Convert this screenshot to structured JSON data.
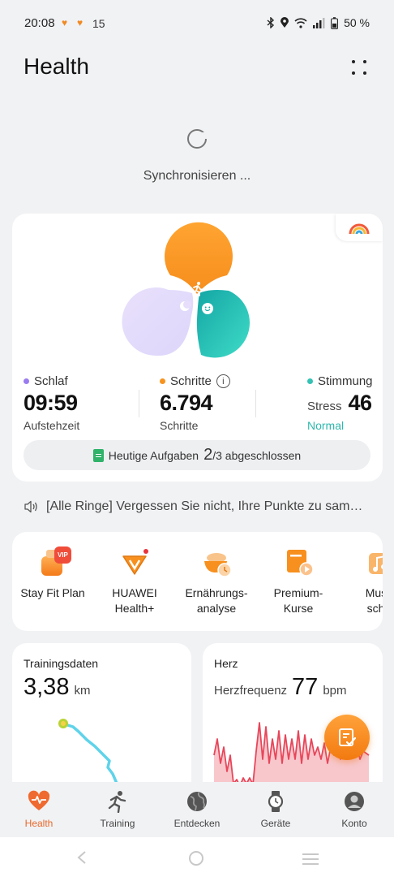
{
  "status_bar": {
    "time": "20:08",
    "temperature": "15",
    "battery": "50 %",
    "icons": [
      "heart-icon",
      "heart-icon",
      "bluetooth-icon",
      "location-icon",
      "wifi-icon",
      "signal-icon"
    ]
  },
  "header": {
    "title": "Health"
  },
  "sync": {
    "text": "Synchronisieren ..."
  },
  "rings": {
    "colors": {
      "sleep": "#ddd6fb",
      "steps": "#f7931e",
      "mood": "#22bfae"
    },
    "sleep": {
      "label": "Schlaf",
      "value": "09:59",
      "sub": "Aufstehzeit",
      "dot_color": "#9a7cf0"
    },
    "steps": {
      "label": "Schritte",
      "info": "i",
      "value": "6.794",
      "sub": "Schritte",
      "dot_color": "#f7931e"
    },
    "mood": {
      "label": "Stimmung",
      "stress_label": "Stress",
      "value": "46",
      "status": "Normal",
      "dot_color": "#34c2b4"
    },
    "tasks": {
      "prefix": "Heutige Aufgaben",
      "done": "2",
      "suffix": "/3 abgeschlossen"
    }
  },
  "announcement": {
    "text": "[Alle Ringe] Vergessen Sie nicht, Ihre Punkte zu sam…"
  },
  "services": [
    {
      "label": "Stay Fit Plan",
      "icon": "stay-fit-icon",
      "badge": "VIP"
    },
    {
      "label": "HUAWEI Health+",
      "icon": "huawei-vip-icon"
    },
    {
      "label": "Ernährungs-analyse",
      "icon": "nutrition-icon"
    },
    {
      "label": "Premium-Kurse",
      "icon": "premium-course-icon"
    },
    {
      "label": "Musik schla",
      "icon": "music-icon"
    }
  ],
  "training": {
    "title": "Trainingsdaten",
    "value": "3,38",
    "unit": "km"
  },
  "heart": {
    "title": "Herz",
    "label": "Herzfrequenz",
    "value": "77",
    "unit": "bpm"
  },
  "tabs": [
    {
      "label": "Health",
      "icon": "heart-pulse-icon",
      "active": true
    },
    {
      "label": "Training",
      "icon": "running-icon",
      "active": false
    },
    {
      "label": "Entdecken",
      "icon": "globe-icon",
      "active": false
    },
    {
      "label": "Geräte",
      "icon": "watch-icon",
      "active": false
    },
    {
      "label": "Konto",
      "icon": "profile-icon",
      "active": false
    }
  ]
}
